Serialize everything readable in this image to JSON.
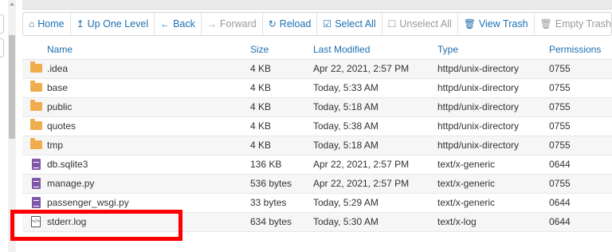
{
  "toolbar": {
    "home_label": "Home",
    "up_label": "Up One Level",
    "back_label": "Back",
    "forward_label": "Forward",
    "reload_label": "Reload",
    "select_all_label": "Select All",
    "unselect_all_label": "Unselect All",
    "view_trash_label": "View Trash",
    "empty_trash_label": "Empty Trash"
  },
  "table": {
    "headers": {
      "name": "Name",
      "size": "Size",
      "modified": "Last Modified",
      "type": "Type",
      "permissions": "Permissions"
    },
    "rows": [
      {
        "name": ".idea",
        "size": "4 KB",
        "modified": "Apr 22, 2021, 2:57 PM",
        "type": "httpd/unix-directory",
        "perm": "0755",
        "icon": "folder-icon"
      },
      {
        "name": "base",
        "size": "4 KB",
        "modified": "Today, 5:33 AM",
        "type": "httpd/unix-directory",
        "perm": "0755",
        "icon": "folder-icon"
      },
      {
        "name": "public",
        "size": "4 KB",
        "modified": "Today, 5:18 AM",
        "type": "httpd/unix-directory",
        "perm": "0755",
        "icon": "folder-icon"
      },
      {
        "name": "quotes",
        "size": "4 KB",
        "modified": "Today, 5:38 AM",
        "type": "httpd/unix-directory",
        "perm": "0755",
        "icon": "folder-icon"
      },
      {
        "name": "tmp",
        "size": "4 KB",
        "modified": "Today, 5:18 AM",
        "type": "httpd/unix-directory",
        "perm": "0755",
        "icon": "folder-icon"
      },
      {
        "name": "db.sqlite3",
        "size": "136 KB",
        "modified": "Apr 22, 2021, 2:57 PM",
        "type": "text/x-generic",
        "perm": "0644",
        "icon": "text-file-icon"
      },
      {
        "name": "manage.py",
        "size": "536 bytes",
        "modified": "Apr 22, 2021, 2:57 PM",
        "type": "text/x-generic",
        "perm": "0755",
        "icon": "text-file-icon"
      },
      {
        "name": "passenger_wsgi.py",
        "size": "33 bytes",
        "modified": "Today, 5:29 AM",
        "type": "text/x-generic",
        "perm": "0644",
        "icon": "text-file-icon"
      },
      {
        "name": "stderr.log",
        "size": "634 bytes",
        "modified": "Today, 5:30 AM",
        "type": "text/x-log",
        "perm": "0644",
        "icon": "log-file-icon"
      }
    ]
  },
  "colors": {
    "link": "#1e6fb0",
    "folder": "#f0ad4e",
    "file": "#7e57a8",
    "highlight": "#ff0000"
  }
}
